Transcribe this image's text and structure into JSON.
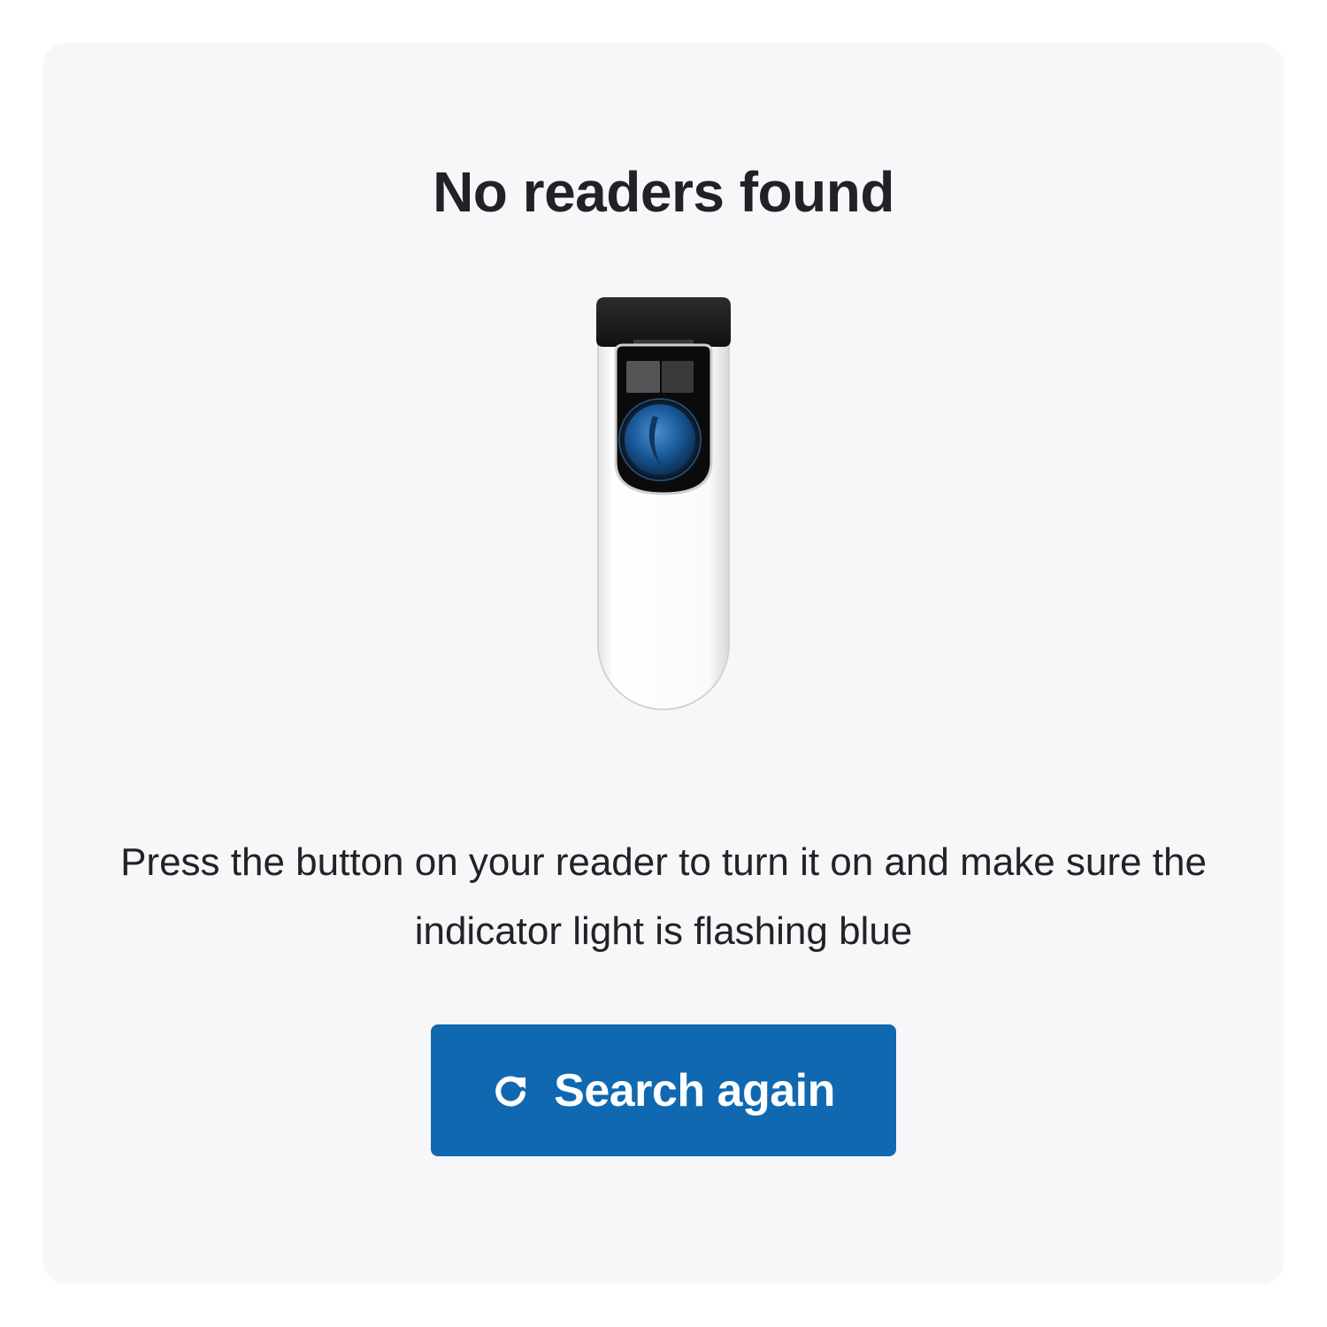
{
  "dialog": {
    "title": "No readers found",
    "message": "Press the button on your reader to turn it on and make sure the indicator light is flashing blue",
    "search_button": {
      "label": "Search again",
      "icon": "refresh-icon",
      "color": "#1069b0"
    },
    "illustration": {
      "subject": "card-reader-device",
      "indicator_color": "#1a5a9a"
    }
  }
}
